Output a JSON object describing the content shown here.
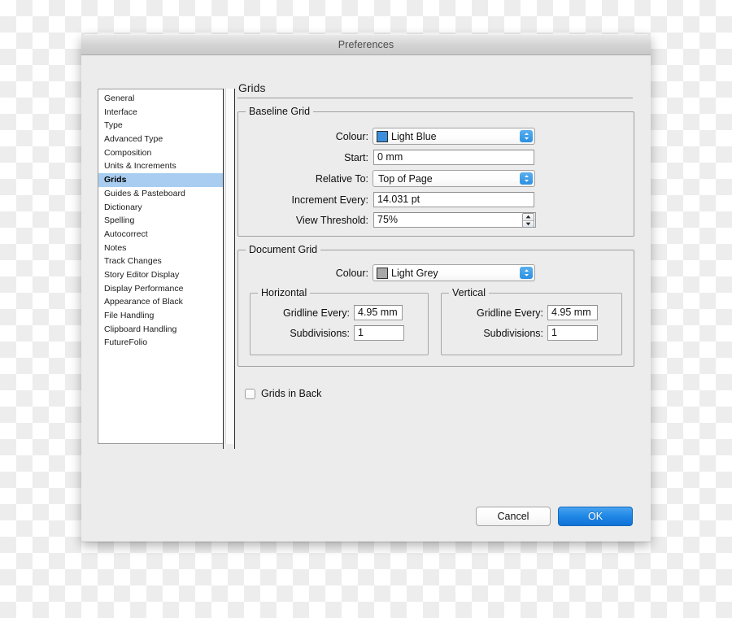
{
  "window": {
    "title": "Preferences"
  },
  "sidebar": {
    "items": [
      {
        "label": "General",
        "selected": false
      },
      {
        "label": "Interface",
        "selected": false
      },
      {
        "label": "Type",
        "selected": false
      },
      {
        "label": "Advanced Type",
        "selected": false
      },
      {
        "label": "Composition",
        "selected": false
      },
      {
        "label": "Units & Increments",
        "selected": false
      },
      {
        "label": "Grids",
        "selected": true
      },
      {
        "label": "Guides & Pasteboard",
        "selected": false
      },
      {
        "label": "Dictionary",
        "selected": false
      },
      {
        "label": "Spelling",
        "selected": false
      },
      {
        "label": "Autocorrect",
        "selected": false
      },
      {
        "label": "Notes",
        "selected": false
      },
      {
        "label": "Track Changes",
        "selected": false
      },
      {
        "label": "Story Editor Display",
        "selected": false
      },
      {
        "label": "Display Performance",
        "selected": false
      },
      {
        "label": "Appearance of Black",
        "selected": false
      },
      {
        "label": "File Handling",
        "selected": false
      },
      {
        "label": "Clipboard Handling",
        "selected": false
      },
      {
        "label": "FutureFolio",
        "selected": false
      }
    ]
  },
  "pane": {
    "title": "Grids",
    "baseline_grid": {
      "legend": "Baseline Grid",
      "colour_label": "Colour:",
      "colour_value": "Light Blue",
      "colour_swatch": "#3b8fdd",
      "start_label": "Start:",
      "start_value": "0 mm",
      "relative_to_label": "Relative To:",
      "relative_to_value": "Top of Page",
      "increment_label": "Increment Every:",
      "increment_value": "14.031 pt",
      "threshold_label": "View Threshold:",
      "threshold_value": "75%"
    },
    "document_grid": {
      "legend": "Document Grid",
      "colour_label": "Colour:",
      "colour_value": "Light Grey",
      "colour_swatch": "#a8a8a8",
      "horizontal": {
        "legend": "Horizontal",
        "gridline_label": "Gridline Every:",
        "gridline_value": "4.95 mm",
        "subdivisions_label": "Subdivisions:",
        "subdivisions_value": "1"
      },
      "vertical": {
        "legend": "Vertical",
        "gridline_label": "Gridline Every:",
        "gridline_value": "4.95 mm",
        "subdivisions_label": "Subdivisions:",
        "subdivisions_value": "1"
      }
    },
    "grids_in_back": {
      "label": "Grids in Back",
      "checked": false
    }
  },
  "footer": {
    "cancel_label": "Cancel",
    "ok_label": "OK",
    "accent_color": "#1f87e5"
  }
}
